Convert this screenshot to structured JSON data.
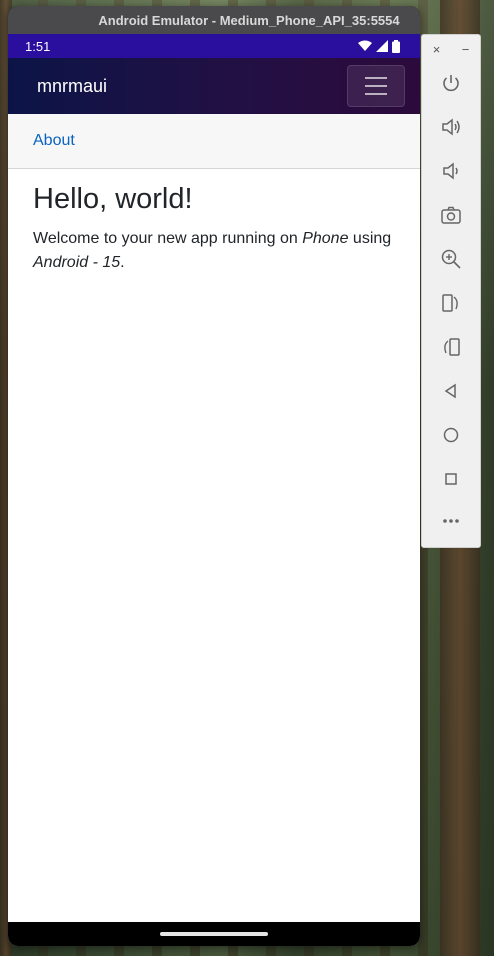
{
  "window": {
    "title": "Android Emulator - Medium_Phone_API_35:5554"
  },
  "status_bar": {
    "time": "1:51"
  },
  "app": {
    "title": "mnrmaui",
    "nav_link": "About",
    "heading": "Hello, world!",
    "body_prefix": "Welcome to your new app running on ",
    "device": "Phone",
    "body_middle": " using ",
    "platform": "Android - 15",
    "body_suffix": "."
  },
  "toolbar": {
    "close_label": "×",
    "minimize_label": "−",
    "buttons": [
      "power-icon",
      "volume-up-icon",
      "volume-down-icon",
      "camera-icon",
      "zoom-in-icon",
      "rotate-left-icon",
      "rotate-right-icon",
      "back-icon",
      "home-icon",
      "overview-icon",
      "more-icon"
    ]
  },
  "colors": {
    "status_bar": "#2a0e9e",
    "app_bar_start": "#0c1447",
    "app_bar_end": "#2c0a3c",
    "link": "#0a63c0"
  }
}
